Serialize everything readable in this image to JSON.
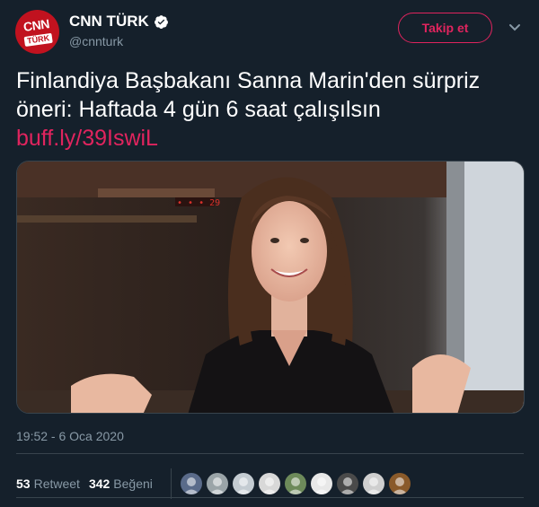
{
  "account": {
    "name": "CNN TÜRK",
    "handle": "@cnnturk",
    "logo_top": "CNN",
    "logo_bottom": "TÜRK"
  },
  "follow_label": "Takip et",
  "tweet": {
    "text": "Finlandiya Başbakanı Sanna Marin'den sürpriz öneri: Haftada 4 gün 6 saat çalışılsın",
    "link": "buff.ly/39IswiL"
  },
  "timestamp": "19:52 - 6 Oca 2020",
  "stats": {
    "retweets_count": "53",
    "retweets_label": "Retweet",
    "likes_count": "342",
    "likes_label": "Beğeni"
  },
  "likers": [
    {
      "icon": "user-avatar-icon",
      "color": "#5a6b8a"
    },
    {
      "icon": "user-avatar-icon",
      "color": "#9aa4a8"
    },
    {
      "icon": "default-user-icon",
      "color": "#c4ccd2"
    },
    {
      "icon": "user-avatar-icon",
      "color": "#d8d8d8"
    },
    {
      "icon": "user-avatar-icon",
      "color": "#6d8a5a"
    },
    {
      "icon": "user-avatar-icon",
      "color": "#e8e8e8"
    },
    {
      "icon": "user-avatar-icon",
      "color": "#4a4a4a"
    },
    {
      "icon": "user-avatar-icon",
      "color": "#cfcfcf"
    },
    {
      "icon": "user-avatar-icon",
      "color": "#8a5a2a"
    }
  ],
  "colors": {
    "background": "#15202b",
    "accent": "#e0245e",
    "secondary_text": "#8899a6",
    "divider": "#38444d"
  }
}
